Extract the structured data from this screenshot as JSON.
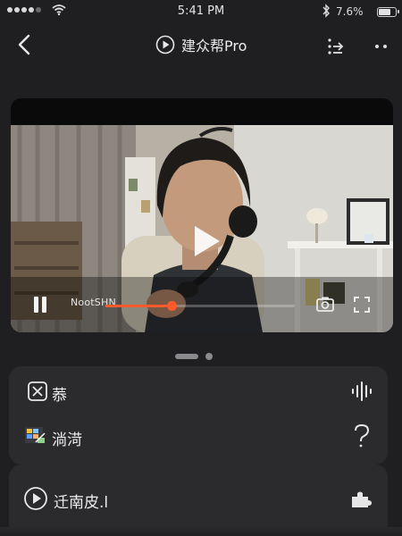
{
  "status_bar": {
    "time": "5:41 PM",
    "battery_percent": "7.6%",
    "battery_level": 0.76,
    "signal_bars_total": 5,
    "signal_bars_active": 4,
    "icons": [
      "signal-icon",
      "wifi-icon",
      "bluetooth-icon",
      "battery-icon"
    ]
  },
  "nav": {
    "title": "建众帮Pro",
    "title_icon": "play-circle-icon",
    "left_icon": "back-chevron-icon",
    "right_icons": [
      "tool-settings-icon",
      "more-icon"
    ]
  },
  "player": {
    "now_label": "NootSHN",
    "progress": 0.35,
    "controls": [
      "pause-icon",
      "snapshot-icon",
      "fullscreen-icon"
    ],
    "accent_color": "#ff5a2c",
    "overlay_icon": "play-icon"
  },
  "pager": {
    "pages": 2,
    "active_index": 0
  },
  "cards": [
    {
      "rows": [
        {
          "label": "菾",
          "icon": "x-square-icon",
          "action_icon": "audio-wave-icon"
        },
        {
          "label": "淌渮",
          "icon": "pixel-image-icon",
          "action_icon": "question-icon"
        }
      ]
    },
    {
      "rows": [
        {
          "label": "迁南皮.l",
          "icon": "play-circle-icon",
          "action_icon": "puzzle-icon"
        }
      ]
    }
  ],
  "colors": {
    "background": "#1f1f21",
    "card": "#2b2b2e",
    "text": "#efeff1",
    "accent": "#ff5a2c"
  }
}
